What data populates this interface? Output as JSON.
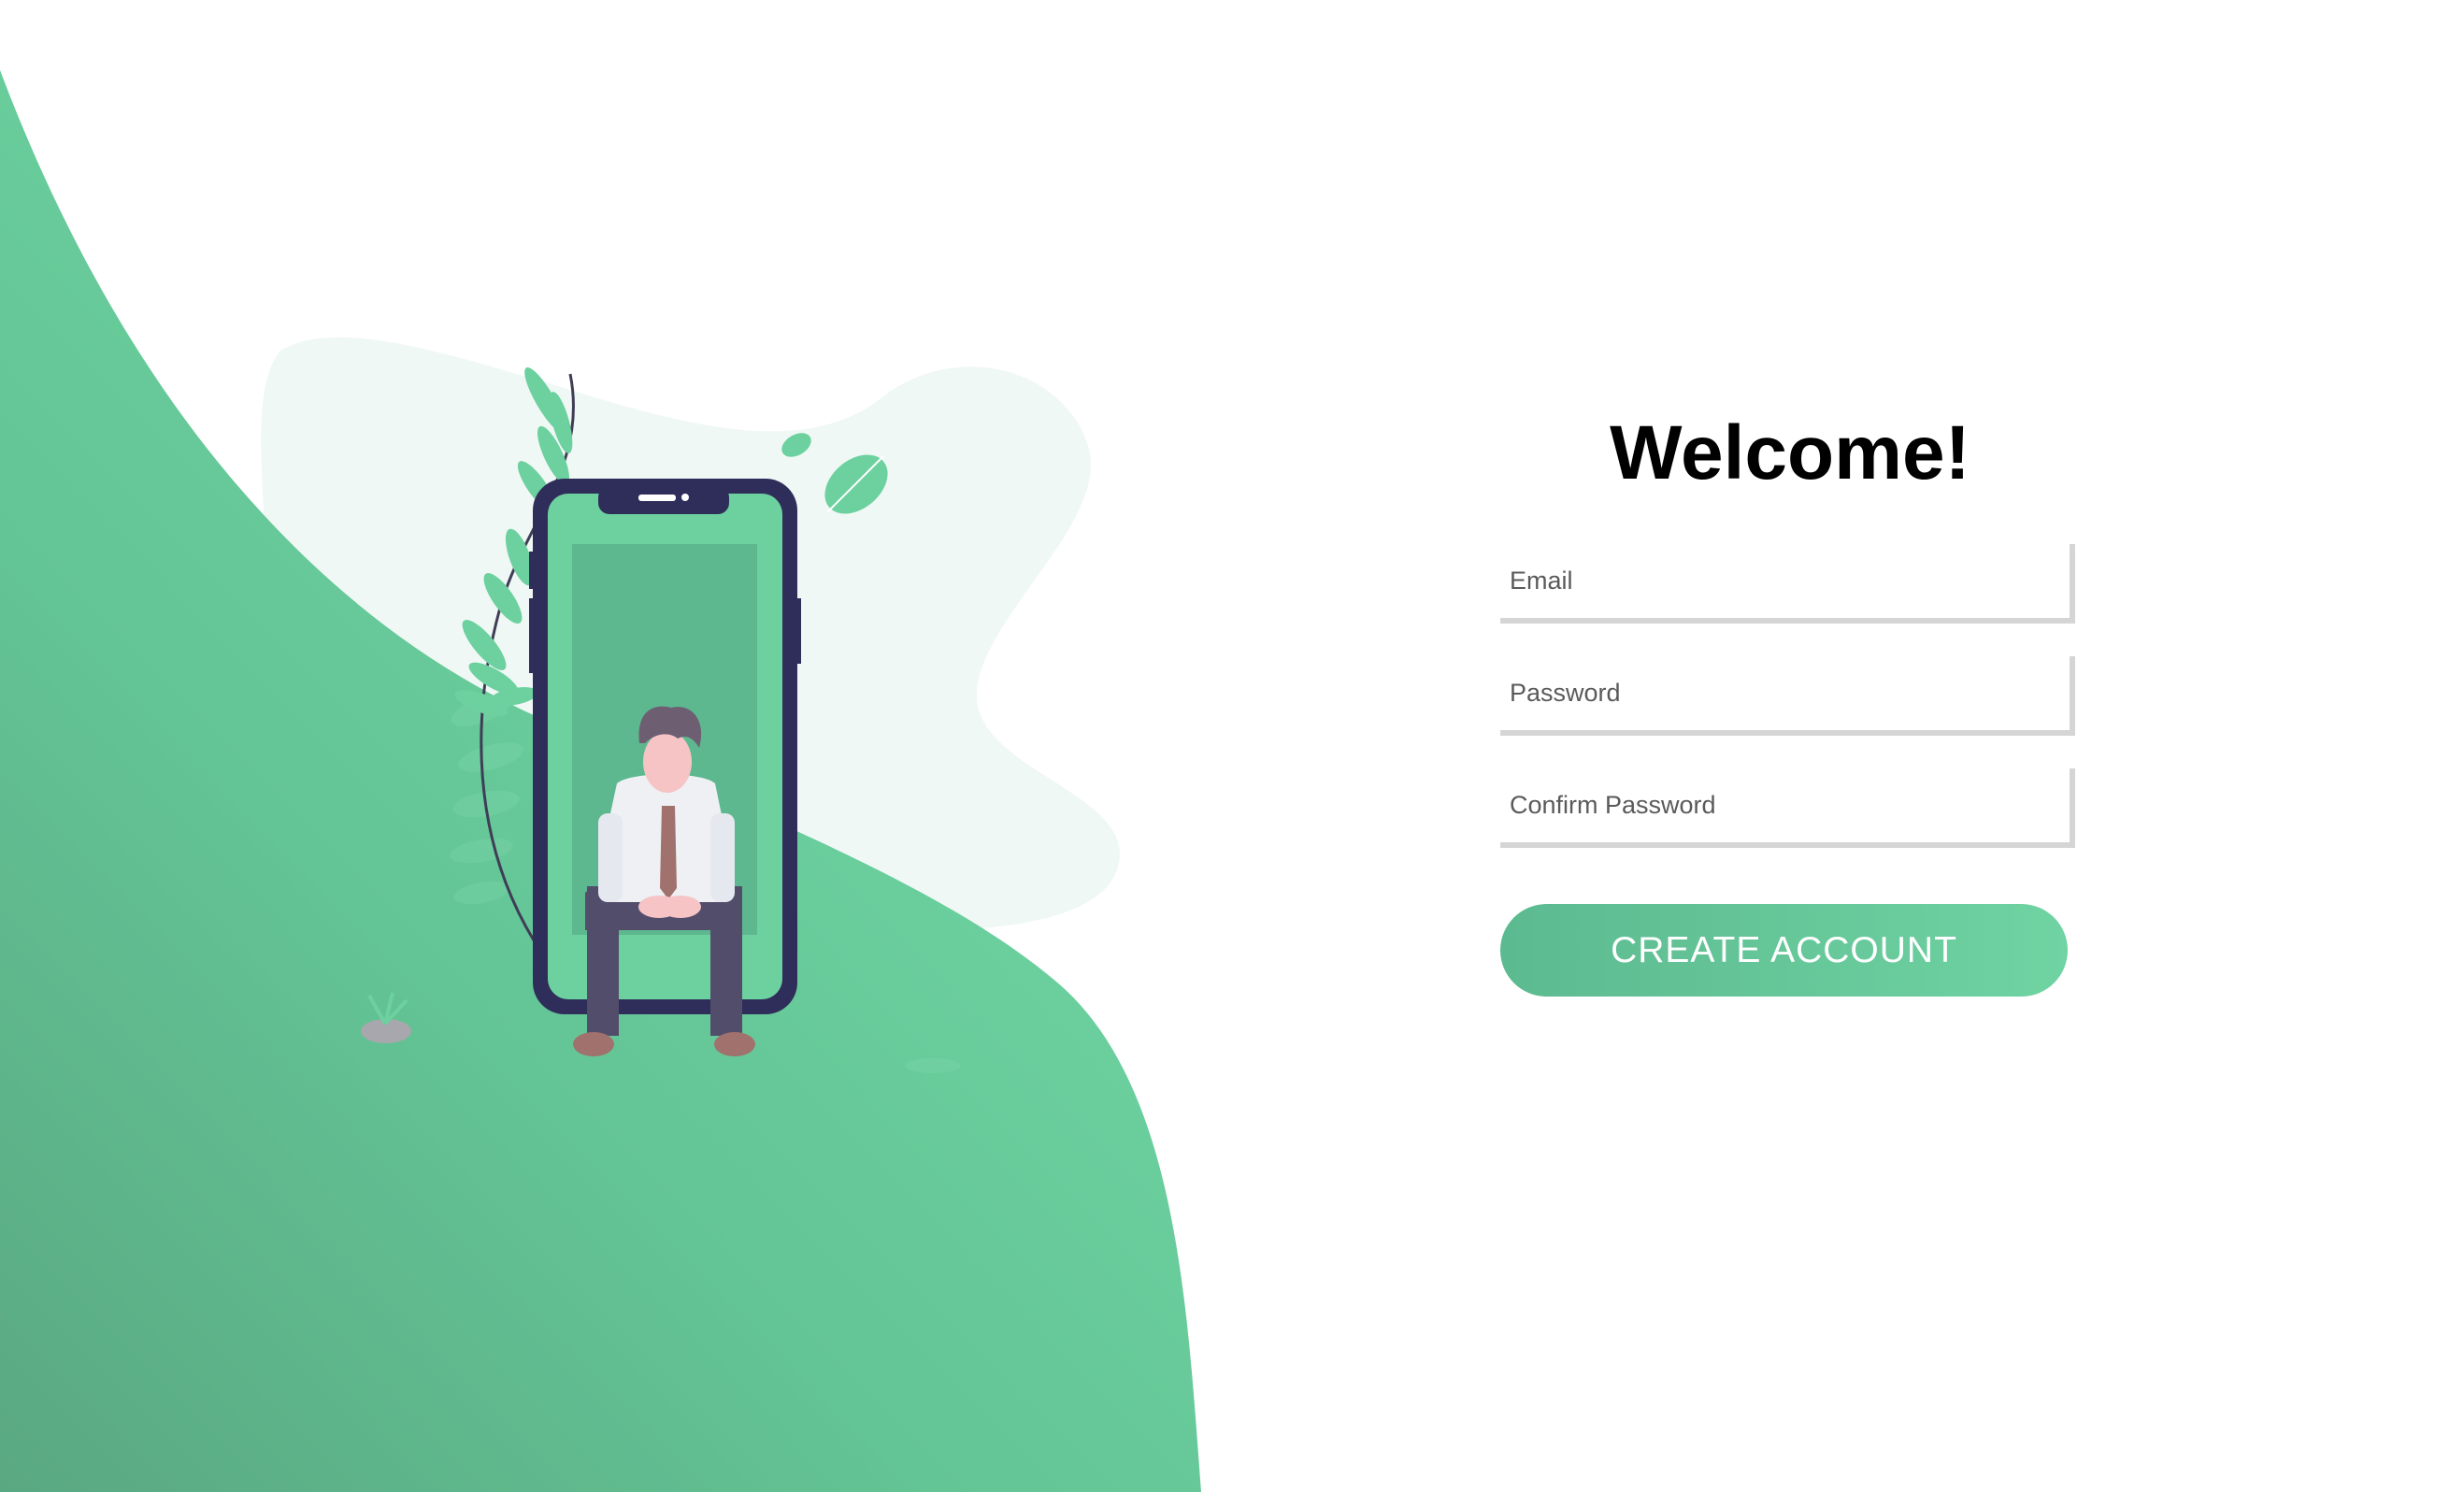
{
  "colors": {
    "accent": "#66cc99",
    "accent_dark": "#5aae8a",
    "blob_light": "#f0f8f5",
    "phone_frame": "#2f2e5a",
    "field_border": "#d5d5d5"
  },
  "form": {
    "title": "Welcome!",
    "email_placeholder": "Email",
    "password_placeholder": "Password",
    "confirm_password_placeholder": "Confirm Password",
    "submit_label": "CREATE ACCOUNT"
  },
  "illustration": {
    "icon": "person-sitting-on-phone-illustration"
  }
}
